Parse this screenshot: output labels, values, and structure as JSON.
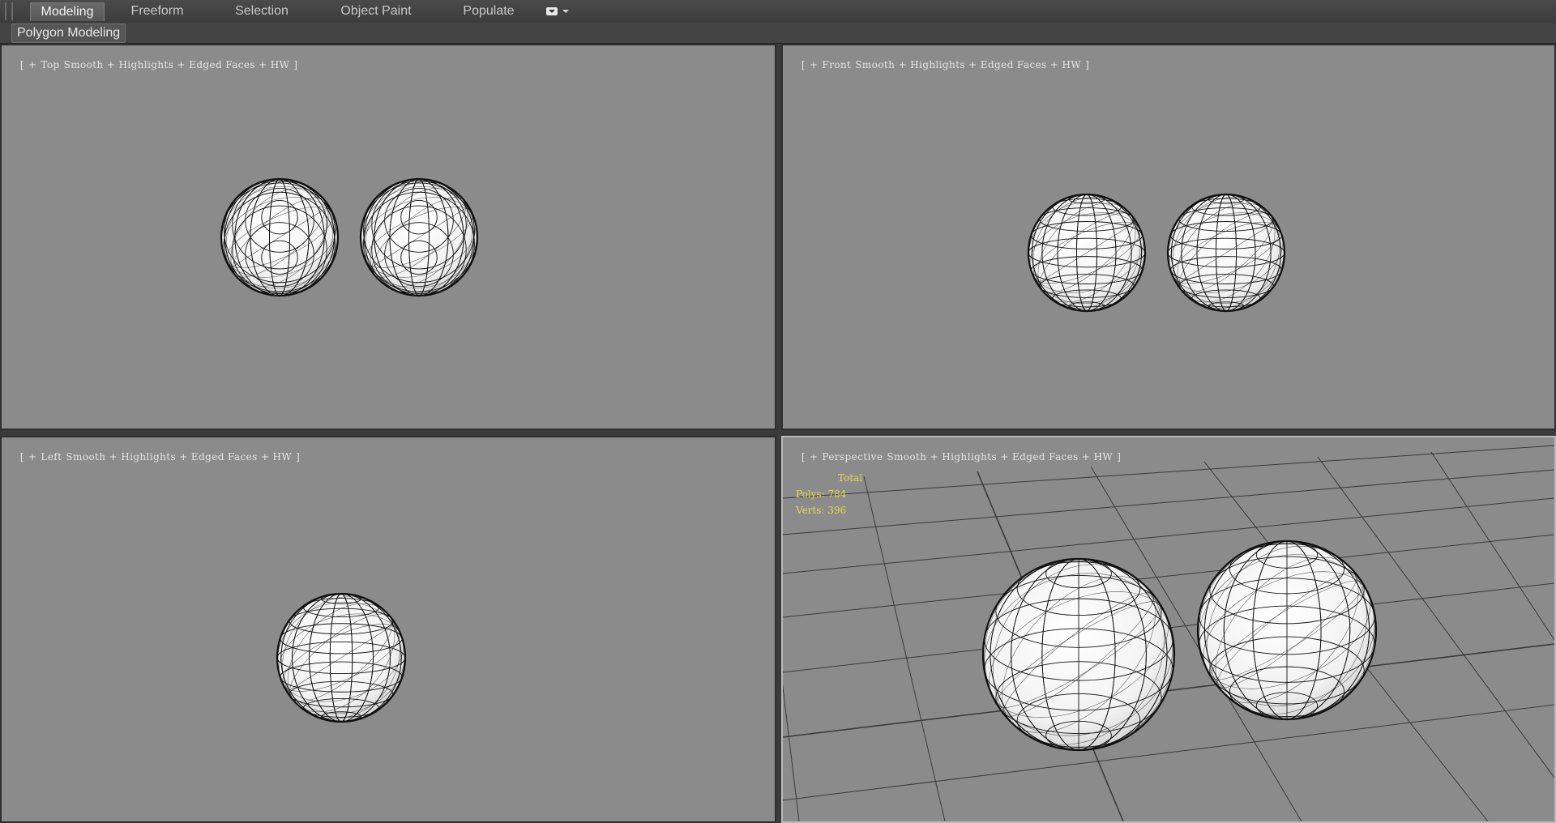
{
  "ribbon": {
    "tabs": [
      {
        "label": "Modeling",
        "active": true
      },
      {
        "label": "Freeform",
        "active": false
      },
      {
        "label": "Selection",
        "active": false
      },
      {
        "label": "Object Paint",
        "active": false
      },
      {
        "label": "Populate",
        "active": false
      }
    ],
    "panel_label": "Polygon Modeling",
    "dropdown_icon": "tab-options-icon"
  },
  "viewports": {
    "top": {
      "plus": "+",
      "name": "Top",
      "shading": "Smooth + Highlights + Edged Faces + HW"
    },
    "front": {
      "plus": "+",
      "name": "Front",
      "shading": "Smooth + Highlights + Edged Faces + HW"
    },
    "left": {
      "plus": "+",
      "name": "Left",
      "shading": "Smooth + Highlights + Edged Faces + HW"
    },
    "perspective": {
      "plus": "+",
      "name": "Perspective",
      "shading": "Smooth + Highlights + Edged Faces + HW"
    }
  },
  "stats": {
    "title": "Total",
    "polys": "Polys: 784",
    "verts": "Verts: 396"
  },
  "colors": {
    "viewport_bg": "#8b8b8b",
    "stats_text": "#e8d84a",
    "active_border": "#b9b9b9",
    "wire": "#111111"
  }
}
